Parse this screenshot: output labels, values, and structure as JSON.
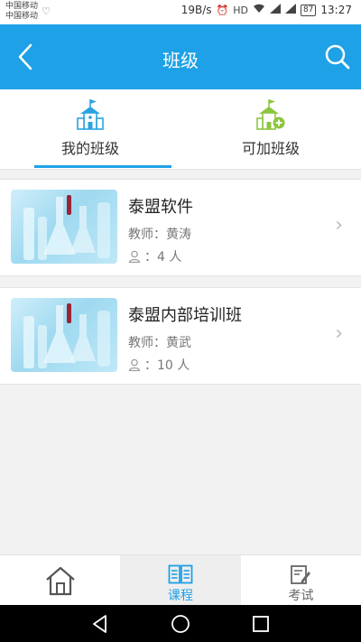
{
  "status_bar": {
    "carrier_1": "中国移动",
    "carrier_2": "中国移动",
    "speed": "19B/s",
    "battery": "87",
    "time": "13:27"
  },
  "app_bar": {
    "title": "班级",
    "back_icon": "back-arrow-icon",
    "search_icon": "search-icon"
  },
  "tabs": [
    {
      "label": "我的班级",
      "icon": "school-icon",
      "active": true
    },
    {
      "label": "可加班级",
      "icon": "school-add-icon",
      "active": false
    }
  ],
  "classes": [
    {
      "name": "泰盟软件",
      "teacher": "教师：黄涛",
      "count": "：4 人"
    },
    {
      "name": "泰盟内部培训班",
      "teacher": "教师：黄武",
      "count": "：10 人"
    }
  ],
  "bottom_nav": [
    {
      "label": "",
      "icon": "home-icon",
      "active": false
    },
    {
      "label": "课程",
      "icon": "book-icon",
      "active": true
    },
    {
      "label": "考试",
      "icon": "exam-icon",
      "active": false
    }
  ],
  "colors": {
    "primary": "#1ea1e6",
    "tab_icon_blue": "#29a3e0",
    "tab_icon_green": "#8cc63f"
  }
}
